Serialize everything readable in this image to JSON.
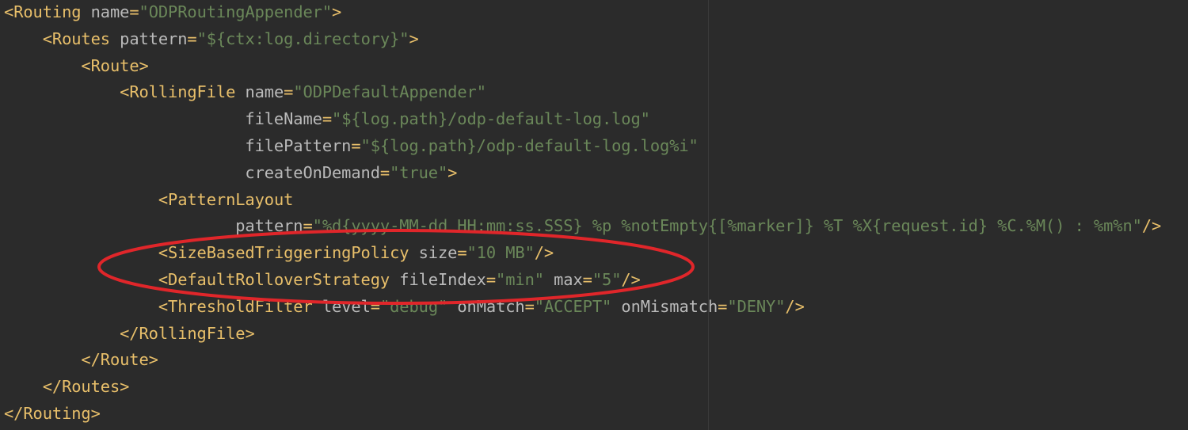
{
  "accent_colors": {
    "background": "#2b2b2b",
    "tag": "#e8bf6a",
    "attribute": "#bababa",
    "value": "#6a8759",
    "annotation": "#e0262a"
  },
  "lines": [
    [
      [
        "punct",
        "<"
      ],
      [
        "tag",
        "Routing"
      ],
      [
        "text",
        " "
      ],
      [
        "attr",
        "name"
      ],
      [
        "punct",
        "="
      ],
      [
        "val",
        "\"ODPRoutingAppender\""
      ],
      [
        "punct",
        ">"
      ]
    ],
    [
      [
        "text",
        "    "
      ],
      [
        "punct",
        "<"
      ],
      [
        "tag",
        "Routes"
      ],
      [
        "text",
        " "
      ],
      [
        "attr",
        "pattern"
      ],
      [
        "punct",
        "="
      ],
      [
        "val",
        "\"${ctx:log.directory}\""
      ],
      [
        "punct",
        ">"
      ]
    ],
    [
      [
        "text",
        "        "
      ],
      [
        "punct",
        "<"
      ],
      [
        "tag",
        "Route"
      ],
      [
        "punct",
        ">"
      ]
    ],
    [
      [
        "text",
        "            "
      ],
      [
        "punct",
        "<"
      ],
      [
        "tag",
        "RollingFile"
      ],
      [
        "text",
        " "
      ],
      [
        "attr",
        "name"
      ],
      [
        "punct",
        "="
      ],
      [
        "val",
        "\"ODPDefaultAppender\""
      ]
    ],
    [
      [
        "text",
        "                         "
      ],
      [
        "attr",
        "fileName"
      ],
      [
        "punct",
        "="
      ],
      [
        "val",
        "\"${log.path}/odp-default-log.log\""
      ]
    ],
    [
      [
        "text",
        "                         "
      ],
      [
        "attr",
        "filePattern"
      ],
      [
        "punct",
        "="
      ],
      [
        "val",
        "\"${log.path}/odp-default-log.log%i\""
      ]
    ],
    [
      [
        "text",
        "                         "
      ],
      [
        "attr",
        "createOnDemand"
      ],
      [
        "punct",
        "="
      ],
      [
        "val",
        "\"true\""
      ],
      [
        "punct",
        ">"
      ]
    ],
    [
      [
        "text",
        "                "
      ],
      [
        "punct",
        "<"
      ],
      [
        "tag",
        "PatternLayout"
      ]
    ],
    [
      [
        "text",
        "                        "
      ],
      [
        "attr",
        "pattern"
      ],
      [
        "punct",
        "="
      ],
      [
        "val",
        "\"%d{yyyy-MM-dd HH:mm:ss.SSS} %p %notEmpty{[%marker]} %T %X{request.id} %C.%M() : %m%n\""
      ],
      [
        "punct",
        "/>"
      ]
    ],
    [
      [
        "text",
        "                "
      ],
      [
        "punct",
        "<"
      ],
      [
        "tag",
        "SizeBasedTriggeringPolicy"
      ],
      [
        "text",
        " "
      ],
      [
        "attr",
        "size"
      ],
      [
        "punct",
        "="
      ],
      [
        "val",
        "\"10 MB\""
      ],
      [
        "punct",
        "/>"
      ]
    ],
    [
      [
        "text",
        "                "
      ],
      [
        "punct",
        "<"
      ],
      [
        "tag",
        "DefaultRolloverStrategy"
      ],
      [
        "text",
        " "
      ],
      [
        "attr",
        "fileIndex"
      ],
      [
        "punct",
        "="
      ],
      [
        "val",
        "\"min\""
      ],
      [
        "text",
        " "
      ],
      [
        "attr",
        "max"
      ],
      [
        "punct",
        "="
      ],
      [
        "val",
        "\"5\""
      ],
      [
        "punct",
        "/>"
      ]
    ],
    [
      [
        "text",
        "                "
      ],
      [
        "punct",
        "<"
      ],
      [
        "tag",
        "ThresholdFilter"
      ],
      [
        "text",
        " "
      ],
      [
        "attr",
        "level"
      ],
      [
        "punct",
        "="
      ],
      [
        "val",
        "\"debug\""
      ],
      [
        "text",
        " "
      ],
      [
        "attr",
        "onMatch"
      ],
      [
        "punct",
        "="
      ],
      [
        "val",
        "\"ACCEPT\""
      ],
      [
        "text",
        " "
      ],
      [
        "attr",
        "onMismatch"
      ],
      [
        "punct",
        "="
      ],
      [
        "val",
        "\"DENY\""
      ],
      [
        "punct",
        "/>"
      ]
    ],
    [
      [
        "text",
        "            "
      ],
      [
        "punct",
        "</"
      ],
      [
        "tag",
        "RollingFile"
      ],
      [
        "punct",
        ">"
      ]
    ],
    [
      [
        "text",
        "        "
      ],
      [
        "punct",
        "</"
      ],
      [
        "tag",
        "Route"
      ],
      [
        "punct",
        ">"
      ]
    ],
    [
      [
        "text",
        "    "
      ],
      [
        "punct",
        "</"
      ],
      [
        "tag",
        "Routes"
      ],
      [
        "punct",
        ">"
      ]
    ],
    [
      [
        "punct",
        "</"
      ],
      [
        "tag",
        "Routing"
      ],
      [
        "punct",
        ">"
      ]
    ]
  ]
}
